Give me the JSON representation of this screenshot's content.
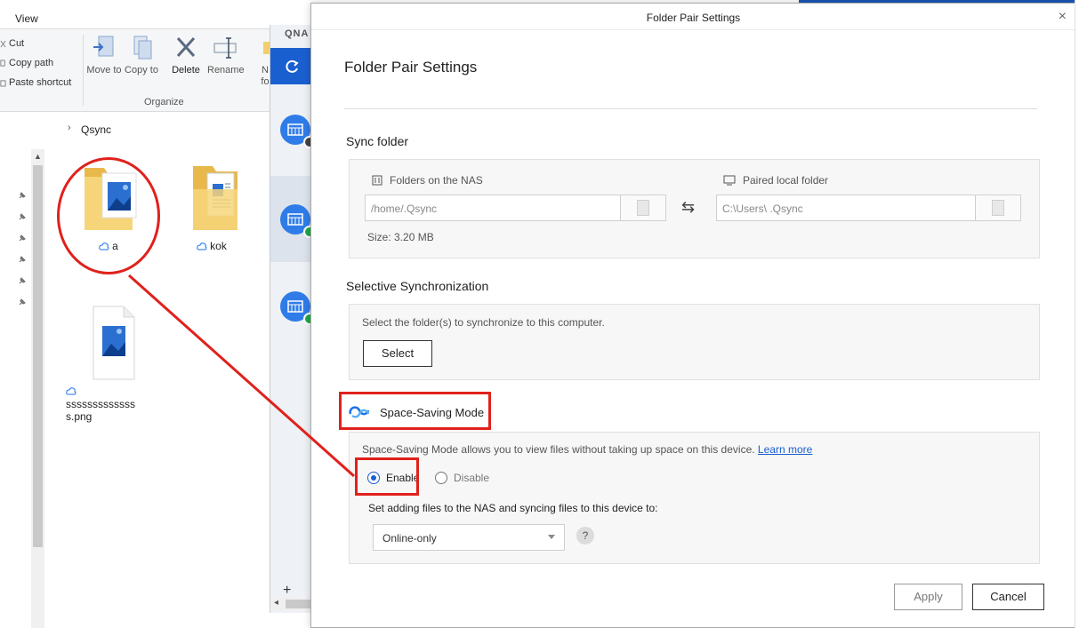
{
  "explorer": {
    "view_tab": "View",
    "clipboard": [
      "Cut",
      "Copy path",
      "Paste shortcut"
    ],
    "organize": {
      "move_to": "Move to",
      "copy_to": "Copy to",
      "delete": "Delete",
      "rename": "Rename",
      "group_label": "Organize"
    },
    "new_folder_partial": "N fo",
    "breadcrumb": "Qsync",
    "files": [
      {
        "name": "a",
        "type": "image-folder",
        "cloud": true
      },
      {
        "name": "kok",
        "type": "document-folder",
        "cloud": true
      },
      {
        "name": "ssssssssssssss.png",
        "type": "image-file",
        "cloud": true
      }
    ]
  },
  "qsync": {
    "logo": "QNA",
    "items": [
      "nas-1",
      "nas-2",
      "nas-3"
    ],
    "add": "+"
  },
  "dialog": {
    "window_title": "Folder Pair Settings",
    "heading": "Folder Pair Settings",
    "sync_folder": {
      "title": "Sync folder",
      "nas_label": "Folders on the NAS",
      "nas_path": "/home/.Qsync",
      "local_label": "Paired local folder",
      "local_path": "C:\\Users\\                    .Qsync",
      "size": "Size: 3.20 MB"
    },
    "selective": {
      "title": "Selective Synchronization",
      "description": "Select the folder(s) to synchronize to this computer.",
      "button": "Select"
    },
    "space_saving": {
      "title": "Space-Saving Mode",
      "description": "Space-Saving Mode allows you to view files without taking up space on this device.",
      "learn_more": "Learn more",
      "enable": "Enable",
      "disable": "Disable",
      "selected": "Enable",
      "set_adding_label": "Set adding files to the NAS and syncing files to this device to:",
      "mode_value": "Online-only",
      "help": "?"
    },
    "apply": "Apply",
    "cancel": "Cancel"
  },
  "colors": {
    "annotation_red": "#e0211c",
    "qnap_blue": "#1a5fcf",
    "sync_green": "#20a84a"
  }
}
